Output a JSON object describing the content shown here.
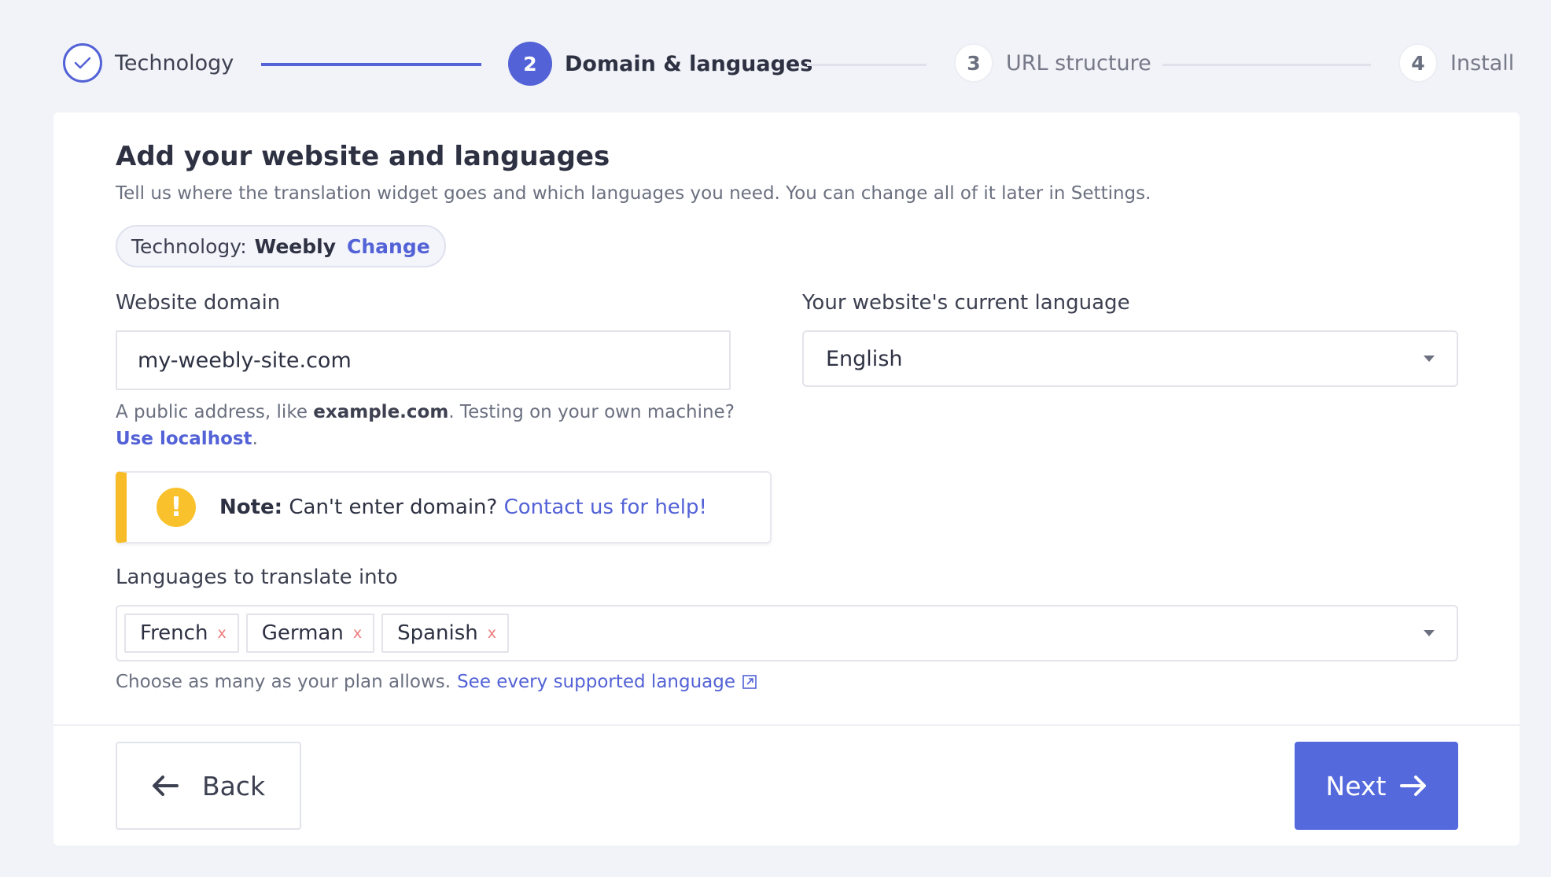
{
  "stepper": {
    "steps": [
      {
        "number": "",
        "label": "Technology",
        "state": "done"
      },
      {
        "number": "2",
        "label": "Domain & languages",
        "state": "active"
      },
      {
        "number": "3",
        "label": "URL structure",
        "state": "todo"
      },
      {
        "number": "4",
        "label": "Install",
        "state": "todo"
      }
    ]
  },
  "form": {
    "title": "Add your website and languages",
    "subtitle": "Tell us where the translation widget goes and which languages you need. You can change all of it later in Settings.",
    "technology": {
      "label": "Technology:",
      "value": "Weebly",
      "change_label": "Change"
    },
    "domain": {
      "label": "Website domain",
      "value": "my-weebly-site.com",
      "helper_prefix": "A public address, like",
      "helper_example": "example.com",
      "helper_suffix": ". Testing on your own machine?",
      "localhost_link": "Use localhost",
      "helper_end": "."
    },
    "note": {
      "prefix": "Note:",
      "text": "Can't enter domain?",
      "link": "Contact us for help!"
    },
    "current_language": {
      "label": "Your website's current language",
      "value": "English"
    },
    "target_languages": {
      "label": "Languages to translate into",
      "tags": [
        "French",
        "German",
        "Spanish"
      ],
      "remove_glyph": "x",
      "helper": "Choose as many as your plan allows.",
      "helper_link": "See every supported language"
    }
  },
  "footer": {
    "back_label": "Back",
    "next_label": "Next"
  },
  "colors": {
    "accent": "#5362d6",
    "warning": "#f7bc28",
    "tag_remove": "#ef7a7a",
    "background": "#f1f3f8"
  }
}
